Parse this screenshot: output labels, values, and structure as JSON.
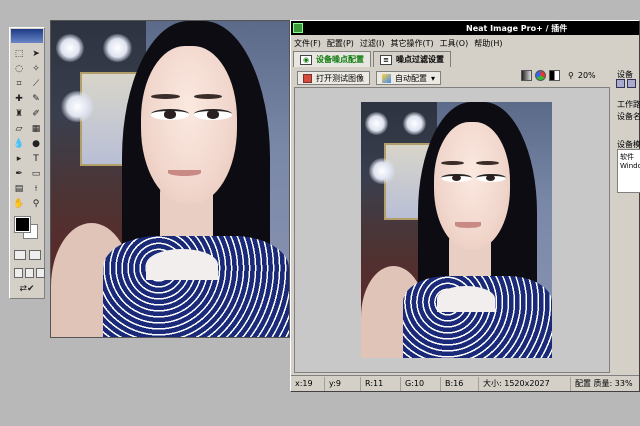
{
  "neat_image": {
    "title": "Neat Image Pro+ / 插件",
    "menu": [
      "文件(F)",
      "配置(P)",
      "过滤(I)",
      "其它操作(T)",
      "工具(O)",
      "帮助(H)"
    ],
    "tabs": [
      {
        "label": "设备噪点配置",
        "icon": "camera-icon",
        "active": true
      },
      {
        "label": "噪点过滤设置",
        "icon": "filter-settings-icon",
        "active": false
      }
    ],
    "toolbar": {
      "open_test_image": "打开测试图像",
      "auto_profile": "自动配置",
      "zoom": "20%"
    },
    "side_panel": {
      "label_top": "设备",
      "label_workspace": "工作路",
      "label_device_name": "设备名",
      "label_device_model": "设备模",
      "box_lines": [
        "软件",
        "Windov"
      ]
    },
    "status": {
      "x": "x:19",
      "y": "y:9",
      "r": "R:11",
      "g": "G:10",
      "b": "B:16",
      "size": "大小: 1520x2027",
      "profile_quality": "配置 质量: 33%"
    }
  },
  "colors": {
    "active_tab_text": "#0a7a0a",
    "title_bar": "#000000",
    "window_face": "#d4d0c8",
    "desktop": "#b8b8b8"
  }
}
